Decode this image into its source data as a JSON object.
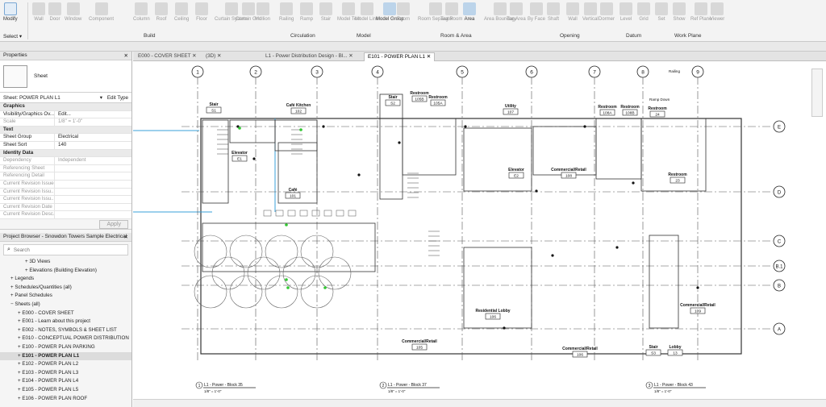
{
  "ribbon": {
    "select": {
      "label": "Modify",
      "dropdown": "Select ▾"
    },
    "tools": [
      {
        "label": "Wall"
      },
      {
        "label": "Door"
      },
      {
        "label": "Window"
      },
      {
        "label": "Component"
      },
      {
        "label": "Column"
      },
      {
        "label": "Roof"
      },
      {
        "label": "Ceiling"
      },
      {
        "label": "Floor"
      },
      {
        "label": "Curtain System"
      },
      {
        "label": "Curtain Grid"
      },
      {
        "label": "Mullion"
      },
      {
        "label": "Railing"
      },
      {
        "label": "Ramp"
      },
      {
        "label": "Stair"
      },
      {
        "label": "Model Text"
      },
      {
        "label": "Model Line"
      },
      {
        "label": "Model Group"
      },
      {
        "label": "Room"
      },
      {
        "label": "Room Separator"
      },
      {
        "label": "Tag Room"
      },
      {
        "label": "Area"
      },
      {
        "label": "Area Boundary"
      },
      {
        "label": "Tag Area"
      },
      {
        "label": "By Face"
      },
      {
        "label": "Shaft"
      },
      {
        "label": "Wall"
      },
      {
        "label": "Vertical"
      },
      {
        "label": "Dormer"
      },
      {
        "label": "Level"
      },
      {
        "label": "Grid"
      },
      {
        "label": "Set"
      },
      {
        "label": "Show"
      },
      {
        "label": "Ref Plane"
      },
      {
        "label": "Viewer"
      }
    ],
    "panels": [
      "Build",
      "Circulation",
      "Model",
      "Room & Area",
      "Opening",
      "Datum",
      "Work Plane"
    ]
  },
  "properties": {
    "title": "Properties",
    "type_name": "Sheet",
    "selector": "Sheet: POWER PLAN L1",
    "edit_type": "Edit Type",
    "rows": [
      {
        "k": "Graphics",
        "v": "",
        "group": true
      },
      {
        "k": "Visibility/Graphics Ov...",
        "v": "Edit..."
      },
      {
        "k": "Scale",
        "v": "1/8\" = 1'-0\"",
        "dim": true
      },
      {
        "k": "Text",
        "v": "",
        "group": true
      },
      {
        "k": "Sheet Group",
        "v": "Electrical"
      },
      {
        "k": "Sheet Sort",
        "v": "140"
      },
      {
        "k": "Identity Data",
        "v": "",
        "group": true
      },
      {
        "k": "Dependency",
        "v": "Independent",
        "dim": true
      },
      {
        "k": "Referencing Sheet",
        "v": "",
        "dim": true
      },
      {
        "k": "Referencing Detail",
        "v": "",
        "dim": true
      },
      {
        "k": "Current Revision Issued",
        "v": "",
        "dim": true
      },
      {
        "k": "Current Revision Issu...",
        "v": "",
        "dim": true
      },
      {
        "k": "Current Revision Issu...",
        "v": "",
        "dim": true
      },
      {
        "k": "Current Revision Date",
        "v": "",
        "dim": true
      },
      {
        "k": "Current Revision Desc...",
        "v": "",
        "dim": true
      }
    ],
    "apply": "Apply"
  },
  "browser": {
    "title": "Project Browser - Snowdon Towers Sample Electrical",
    "search_placeholder": "Search",
    "items": [
      {
        "label": "3D Views",
        "indent": 3,
        "icon": "+"
      },
      {
        "label": "Elevations (Building Elevation)",
        "indent": 3,
        "icon": "+"
      },
      {
        "label": "Legends",
        "indent": 1,
        "icon": "+"
      },
      {
        "label": "Schedules/Quantities (all)",
        "indent": 1,
        "icon": "+"
      },
      {
        "label": "Panel Schedules",
        "indent": 1,
        "icon": "+"
      },
      {
        "label": "Sheets (all)",
        "indent": 1,
        "icon": "−"
      },
      {
        "label": "E000 - COVER SHEET",
        "indent": 2,
        "icon": "+"
      },
      {
        "label": "E001 - Learn about this project",
        "indent": 2,
        "icon": "+"
      },
      {
        "label": "E002 - NOTES, SYMBOLS & SHEET LIST",
        "indent": 2,
        "icon": "+"
      },
      {
        "label": "E010 - CONCEPTUAL POWER DISTRIBUTION",
        "indent": 2,
        "icon": "+"
      },
      {
        "label": "E100 - POWER PLAN PARKING",
        "indent": 2,
        "icon": "+"
      },
      {
        "label": "E101 - POWER PLAN L1",
        "indent": 2,
        "icon": "+",
        "selected": true
      },
      {
        "label": "E102 - POWER PLAN L2",
        "indent": 2,
        "icon": "+"
      },
      {
        "label": "E103 - POWER PLAN L3",
        "indent": 2,
        "icon": "+"
      },
      {
        "label": "E104 - POWER PLAN L4",
        "indent": 2,
        "icon": "+"
      },
      {
        "label": "E105 - POWER PLAN L5",
        "indent": 2,
        "icon": "+"
      },
      {
        "label": "E106 - POWER PLAN ROOF",
        "indent": 2,
        "icon": "+"
      }
    ]
  },
  "tabs": [
    {
      "label": "E000 - COVER SHEET"
    },
    {
      "label": "(3D)"
    },
    {
      "label": "L1 - Power Distribution Design - Bl..."
    },
    {
      "label": "E101 - POWER PLAN L1",
      "active": true
    }
  ],
  "drawing": {
    "grid_top": [
      "1",
      "2",
      "3",
      "4",
      "5",
      "6",
      "7",
      "8",
      "9"
    ],
    "grid_right": [
      "E",
      "D",
      "C",
      "B.1",
      "B",
      "A"
    ],
    "rooms": [
      {
        "name": "Stair",
        "num": "S1"
      },
      {
        "name": "Café Kitchen",
        "num": "102"
      },
      {
        "name": "Elevator",
        "num": "E1"
      },
      {
        "name": "Café",
        "num": "101"
      },
      {
        "name": "Stair",
        "num": "S2"
      },
      {
        "name": "Restroom",
        "num": "105B"
      },
      {
        "name": "Restroom",
        "num": "105A"
      },
      {
        "name": "Utility",
        "num": "107"
      },
      {
        "name": "Elevator",
        "num": "E2"
      },
      {
        "name": "Restroom",
        "num": "108A"
      },
      {
        "name": "Restroom",
        "num": "108B"
      },
      {
        "name": "Restroom",
        "num": "24"
      },
      {
        "name": "Restroom",
        "num": "23"
      },
      {
        "name": "Commercial/Retail",
        "num": "108"
      },
      {
        "name": "Residential Lobby",
        "num": "106"
      },
      {
        "name": "Commercial/Retail",
        "num": "105"
      },
      {
        "name": "Commercial/Retail",
        "num": "106"
      },
      {
        "name": "Commercial/Retail",
        "num": "109"
      },
      {
        "name": "Stair",
        "num": "S3"
      },
      {
        "name": "Lobby",
        "num": "13"
      }
    ],
    "labels": {
      "railing": "Railing",
      "ramp": "Ramp Down"
    },
    "titles": [
      {
        "num": "1",
        "name": "L1 - Power - Block 35",
        "scale": "1/8\" = 1'-0\""
      },
      {
        "num": "2",
        "name": "L1 - Power - Block 37",
        "scale": "1/8\" = 1'-0\""
      },
      {
        "num": "3",
        "name": "L1 - Power - Block 43",
        "scale": "1/8\" = 1'-0\""
      }
    ]
  },
  "colors": {
    "accent": "#0a72c4",
    "tab_active": "#ffffff"
  }
}
